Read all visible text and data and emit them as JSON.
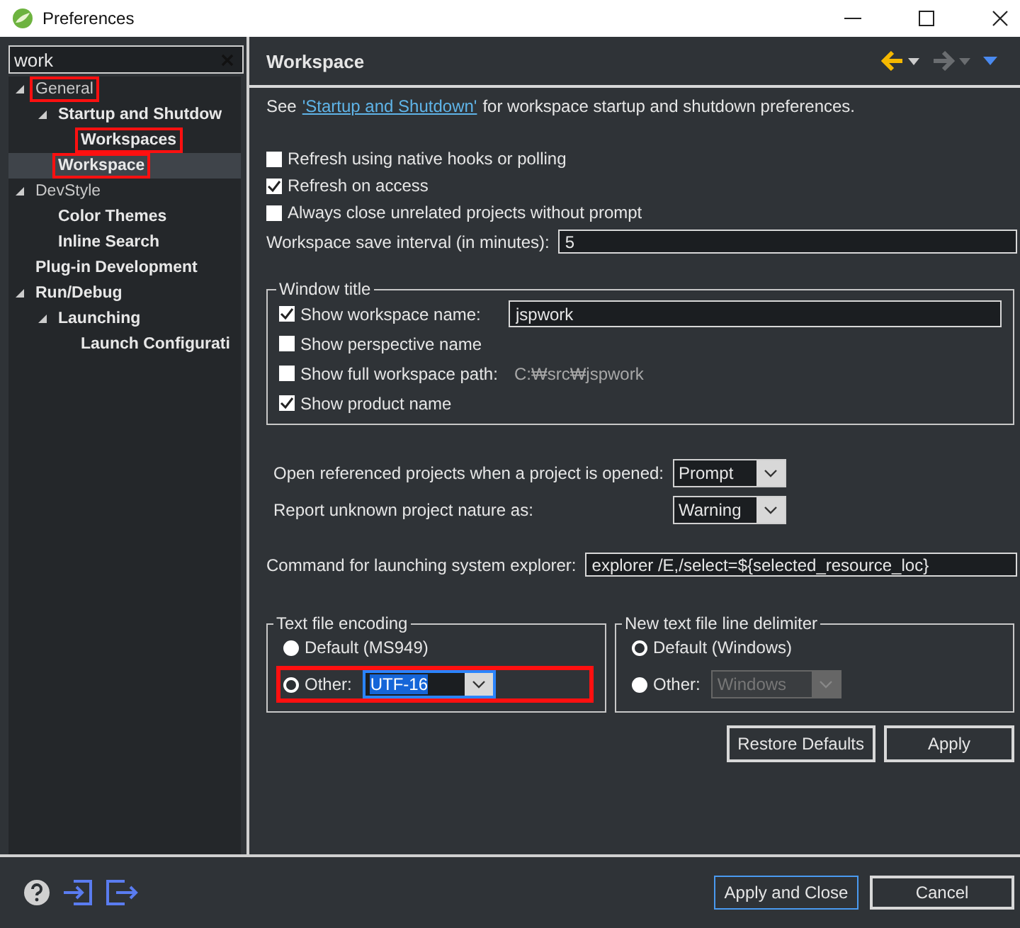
{
  "window": {
    "title": "Preferences"
  },
  "filter": {
    "value": "work"
  },
  "tree": [
    {
      "label": "General",
      "match": false,
      "highlighted": true,
      "selected": false,
      "expanded": true,
      "children": [
        {
          "label": "Startup and Shutdow",
          "match": true,
          "highlighted": false,
          "selected": false,
          "expanded": true,
          "children": [
            {
              "label": "Workspaces",
              "match": true,
              "highlighted": true,
              "selected": false
            }
          ]
        },
        {
          "label": "Workspace",
          "match": true,
          "highlighted": true,
          "selected": true
        }
      ]
    },
    {
      "label": "DevStyle",
      "match": false,
      "highlighted": false,
      "selected": false,
      "expanded": true,
      "children": [
        {
          "label": "Color Themes",
          "match": true,
          "highlighted": false,
          "selected": false
        },
        {
          "label": "Inline Search",
          "match": true,
          "highlighted": false,
          "selected": false
        }
      ]
    },
    {
      "label": "Plug-in Development",
      "match": true,
      "highlighted": false,
      "selected": false
    },
    {
      "label": "Run/Debug",
      "match": true,
      "highlighted": false,
      "selected": false,
      "expanded": true,
      "children": [
        {
          "label": "Launching",
          "match": true,
          "highlighted": false,
          "selected": false,
          "expanded": true,
          "children": [
            {
              "label": "Launch Configurati",
              "match": true,
              "highlighted": false,
              "selected": false
            }
          ]
        }
      ]
    }
  ],
  "page": {
    "title": "Workspace",
    "intro": {
      "before": "See",
      "link": "'Startup and Shutdown'",
      "after": "for workspace startup and shutdown preferences."
    },
    "options": [
      {
        "label": "Refresh using native hooks or polling",
        "checked": false
      },
      {
        "label": "Refresh on access",
        "checked": true
      },
      {
        "label": "Always close unrelated projects without prompt",
        "checked": false
      }
    ],
    "save_interval": {
      "label": "Workspace save interval (in minutes):",
      "value": "5"
    },
    "window_title": {
      "legend": "Window title",
      "items": [
        {
          "kind": "field",
          "label": "Show workspace name:",
          "checked": true,
          "value": "jspwork"
        },
        {
          "kind": "plain",
          "label": "Show perspective name",
          "checked": false
        },
        {
          "kind": "path",
          "label": "Show full workspace path:",
          "checked": false,
          "value": "C:₩src₩jspwork"
        },
        {
          "kind": "plain",
          "label": "Show product name",
          "checked": true
        }
      ]
    },
    "combos": [
      {
        "label": "Open referenced projects when a project is opened:",
        "value": "Prompt"
      },
      {
        "label": "Report unknown project nature as:",
        "value": "Warning"
      }
    ],
    "explorer": {
      "label": "Command for launching system explorer:",
      "value": "explorer /E,/select=${selected_resource_loc}"
    },
    "encoding": {
      "legend": "Text file encoding",
      "options": [
        {
          "label": "Default (MS949)",
          "selected": false
        },
        {
          "label": "Other:",
          "selected": true,
          "value": "UTF-16",
          "disabled": false,
          "highlighted": true
        }
      ]
    },
    "delimiter": {
      "legend": "New text file line delimiter",
      "options": [
        {
          "label": "Default (Windows)",
          "selected": true
        },
        {
          "label": "Other:",
          "selected": false,
          "value": "Windows",
          "disabled": true,
          "highlighted": false
        }
      ]
    },
    "buttons": [
      "Restore Defaults",
      "Apply"
    ]
  },
  "footer": {
    "buttons": [
      {
        "label": "Apply and Close",
        "focused": true
      },
      {
        "label": "Cancel",
        "focused": false
      }
    ]
  }
}
